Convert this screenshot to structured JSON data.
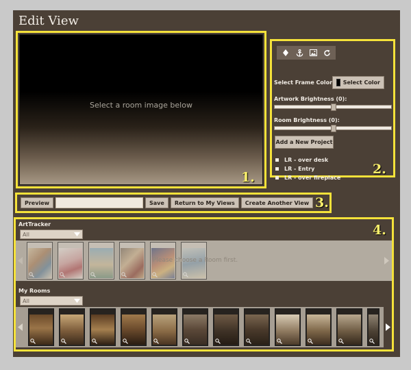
{
  "page": {
    "title": "Edit View"
  },
  "annotations": {
    "box1": "1.",
    "box2": "2.",
    "box3": "3.",
    "box4": "4."
  },
  "preview": {
    "message": "Select a room image below"
  },
  "controls": {
    "tools": [
      {
        "icon": "drop-pin-icon"
      },
      {
        "icon": "anchor-icon"
      },
      {
        "icon": "image-icon"
      },
      {
        "icon": "refresh-icon"
      }
    ],
    "frame_color_label": "Select Frame Color:",
    "frame_color_value": "#000000",
    "select_color_button": "Select Color",
    "artwork_brightness_label": "Artwork Brightness (0):",
    "artwork_brightness": 0,
    "room_brightness_label": "Room Brightness (0):",
    "room_brightness": 0,
    "add_project_button": "Add a New Project",
    "rooms": [
      "LR - over desk",
      "LR - Entry",
      "LR - over fireplace"
    ]
  },
  "actions": {
    "preview_button": "Preview",
    "name_value": "",
    "save_button": "Save",
    "return_button": "Return to My Views",
    "create_button": "Create Another View"
  },
  "gallery": {
    "arttracker": {
      "title": "ArtTracker",
      "filter_value": "All",
      "overlay_message": "Please choose a Room first."
    },
    "my_rooms": {
      "title": "My Rooms",
      "filter_value": "All"
    }
  },
  "colors": {
    "background": "#4b4036",
    "highlight_border": "#f5e23a",
    "button": "#ccc2b6"
  }
}
